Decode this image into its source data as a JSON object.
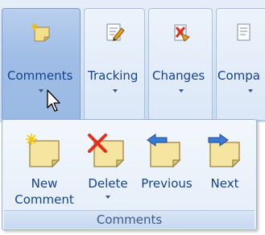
{
  "ribbon": {
    "groups": [
      {
        "label": "Comments",
        "icon": "new-comment-icon",
        "selected": true
      },
      {
        "label": "Tracking",
        "icon": "tracking-icon"
      },
      {
        "label": "Changes",
        "icon": "changes-icon"
      },
      {
        "label": "Compa",
        "icon": "compare-icon"
      }
    ]
  },
  "panel": {
    "buttons": [
      {
        "line1": "New",
        "line2": "Comment",
        "icon": "new-comment-icon"
      },
      {
        "line1": "Delete",
        "icon": "delete-comment-icon",
        "has_dropdown": true
      },
      {
        "line1": "Previous",
        "icon": "previous-comment-icon"
      },
      {
        "line1": "Next",
        "icon": "next-comment-icon"
      }
    ],
    "group_label": "Comments"
  },
  "colors": {
    "accent": "#15428b",
    "note_fill": "#f5e5a0",
    "delete_red": "#e03020",
    "arrow_blue": "#3a7bd5"
  }
}
